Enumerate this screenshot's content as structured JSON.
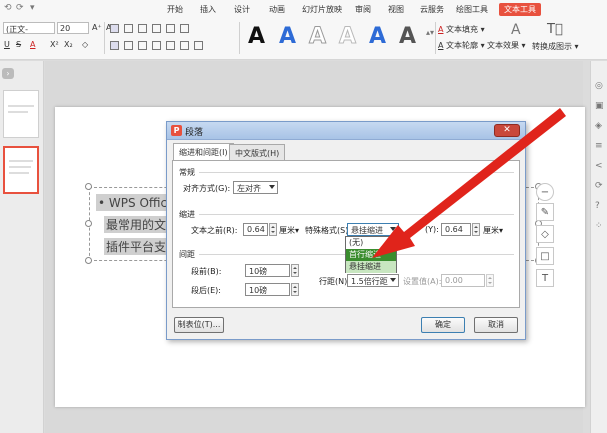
{
  "quick_access": {
    "redo": "⟲",
    "undo": "⟳",
    "more": "▾"
  },
  "menu": {
    "tabs": [
      "开始",
      "插入",
      "设计",
      "动画",
      "幻灯片放映",
      "审阅",
      "视图",
      "云服务",
      "绘图工具",
      "文本工具"
    ],
    "active_index": 9
  },
  "ribbon": {
    "font_name": "(正文-",
    "font_size": "20",
    "grow_font": "A⁺",
    "shrink_font": "A⁻",
    "styles": [
      "A",
      "A",
      "A",
      "A",
      "A",
      "A"
    ],
    "style_colors": [
      "#111111",
      "#2e6bd6",
      "#9a9a9a",
      "#b9b9b9",
      "#2e6bd6",
      "#555555"
    ],
    "text_fill": "文本填充",
    "text_outline": "文本轮廓",
    "text_effect": "文本效果",
    "convert": "转换成图示"
  },
  "slide": {
    "lines": [
      "WPS Office是由",
      "最常用的文字、",
      "插件平台支持、"
    ]
  },
  "dialog": {
    "logo": "P",
    "title": "段落",
    "close": "✕",
    "tabs": [
      "缩进和间距(I)",
      "中文版式(H)"
    ],
    "section_general": "常规",
    "align_label": "对齐方式(G):",
    "align_value": "左对齐",
    "section_indent": "缩进",
    "before_text_label": "文本之前(R):",
    "before_text_value": "0.64",
    "before_text_unit": "厘米",
    "special_label": "特殊格式(S):",
    "special_value": "悬挂缩进",
    "measure_label": "(Y):",
    "measure_value": "0.64",
    "measure_unit": "厘米",
    "section_spacing": "间距",
    "before_label": "段前(B):",
    "before_value": "10磅",
    "after_label": "段后(E):",
    "after_value": "10磅",
    "line_label": "行距(N):",
    "line_value": "1.5倍行距",
    "setvalue_label": "设置值(A):",
    "setvalue_value": "0.00",
    "tabs_button": "制表位(T)...",
    "ok": "确定",
    "cancel": "取消",
    "dropdown_options": [
      "(无)",
      "首行缩进",
      "悬挂缩进"
    ],
    "dropdown_highlight_index": 1
  },
  "colors": {
    "accent": "#e8513e",
    "arrow": "#e0241b",
    "highlight": "#3a8d2e"
  }
}
